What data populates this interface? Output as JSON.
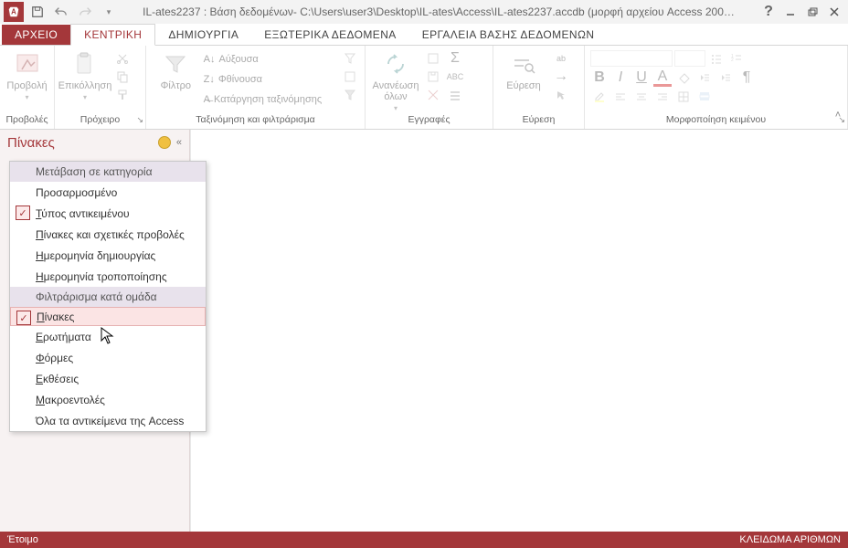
{
  "titlebar": {
    "title": "IL-ates2237 : Βάση δεδομένων- C:\\Users\\user3\\Desktop\\IL-ates\\Access\\IL-ates2237.accdb (μορφή αρχείου Access 200…"
  },
  "tabs": {
    "file": "ΑΡΧΕΙΟ",
    "home": "ΚΕΝΤΡΙΚΗ",
    "create": "ΔΗΜΙΟΥΡΓΙΑ",
    "external": "ΕΞΩΤΕΡΙΚΑ ΔΕΔΟΜΕΝΑ",
    "dbtools": "ΕΡΓΑΛΕΙΑ ΒΑΣΗΣ ΔΕΔΟΜΕΝΩΝ"
  },
  "ribbon": {
    "views": {
      "btn": "Προβολή",
      "label": "Προβολές"
    },
    "clipboard": {
      "paste": "Επικόλληση",
      "label": "Πρόχειρο"
    },
    "sortfilter": {
      "filter": "Φίλτρο",
      "asc": "Αύξουσα",
      "desc": "Φθίνουσα",
      "clear": "Κατάργηση ταξινόμησης",
      "label": "Ταξινόμηση και φιλτράρισμα"
    },
    "records": {
      "refresh": "Ανανέωση όλων",
      "label": "Εγγραφές"
    },
    "find": {
      "btn": "Εύρεση",
      "label": "Εύρεση"
    },
    "textfmt": {
      "label": "Μορφοποίηση κειμένου"
    }
  },
  "nav": {
    "header": "Πίνακες"
  },
  "menu": {
    "header1": "Μετάβαση σε κατηγορία",
    "custom": "Προσαρμοσμένο",
    "objtype": "Τύπος αντικειμένου",
    "relviews": "Πίνακες και σχετικές προβολές",
    "created": "Ημερομηνία δημιουργίας",
    "modified": "Ημερομηνία τροποποίησης",
    "header2": "Φιλτράρισμα κατά ομάδα",
    "tables": "Πίνακες",
    "queries": "Ερωτήματα",
    "forms": "Φόρμες",
    "reports": "Εκθέσεις",
    "macros": "Μακροεντολές",
    "all": "Όλα τα αντικείμενα της Access"
  },
  "status": {
    "ready": "Έτοιμο",
    "numlock": "ΚΛΕΙΔΩΜΑ ΑΡΙΘΜΩΝ"
  }
}
